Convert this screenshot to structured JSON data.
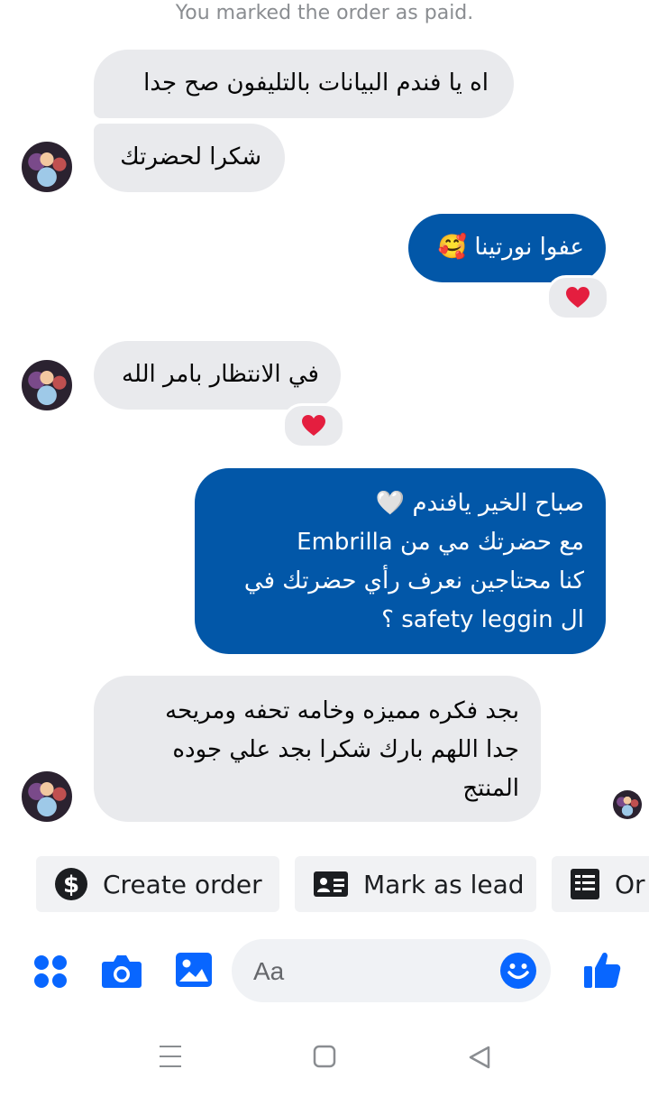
{
  "system_note": "You marked the order as paid.",
  "messages": [
    {
      "text": "اه يا فندم البيانات بالتليفون صح جدا"
    },
    {
      "text": "شكرا لحضرتك"
    },
    {
      "text": "عفوا نورتينا",
      "emoji": "🥰",
      "reaction": "❤️"
    },
    {
      "text": "في الانتظار بامر الله",
      "reaction": "❤️"
    },
    {
      "lines": [
        "صباح الخير يافندم",
        "مع حضرتك مي من Embrilla",
        "كنا محتاجين نعرف رأي حضرتك في",
        "ال safety leggin ؟"
      ],
      "emoji": "🤍"
    },
    {
      "lines": [
        "بجد فكره مميزه وخامه تحفه ومريحه",
        "جدا اللهم بارك شكرا بجد علي جوده",
        "المنتج"
      ]
    }
  ],
  "quick_actions": [
    {
      "label": "Create order",
      "icon": "dollar-icon"
    },
    {
      "label": "Mark as lead",
      "icon": "contact-card-icon"
    },
    {
      "label": "Or",
      "icon": "order-list-icon"
    }
  ],
  "composer": {
    "placeholder": "Aa"
  },
  "colors": {
    "accent": "#0866ff",
    "outgoing_bubble": "#0257a8",
    "incoming_bubble": "#e9eaed",
    "reaction_heart": "#e41e3f"
  },
  "icons": {
    "toolbar": [
      "menu-dots-icon",
      "camera-icon",
      "gallery-icon",
      "emoji-icon",
      "like-icon"
    ],
    "nav": [
      "recents-icon",
      "home-icon",
      "back-icon"
    ]
  }
}
